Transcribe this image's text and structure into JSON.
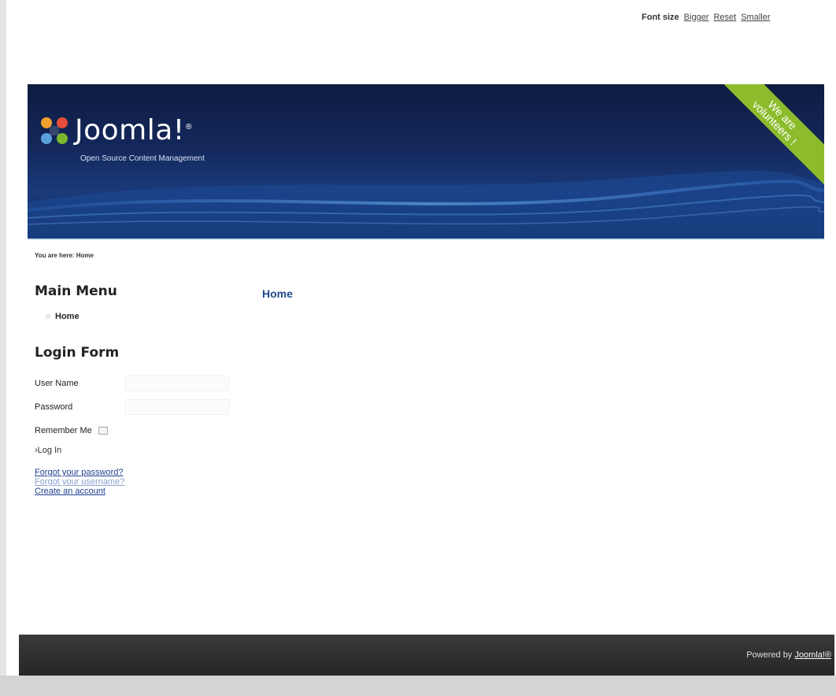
{
  "fontsize": {
    "label": "Font size",
    "bigger": "Bigger",
    "reset": "Reset",
    "smaller": "Smaller"
  },
  "header": {
    "logo_text": "Joomla!",
    "logo_reg": "®",
    "tagline": "Open Source Content Management",
    "ribbon_line1": "We are",
    "ribbon_line2": "volunteers !",
    "colors": {
      "background": "#13275a",
      "ribbon": "#8cbc2c"
    },
    "logo_icon": "joomla-logo-icon"
  },
  "breadcrumb": {
    "text": "You are here: Home"
  },
  "main_menu": {
    "title": "Main Menu",
    "items": [
      {
        "label": "Home"
      }
    ]
  },
  "login_form": {
    "title": "Login Form",
    "username_label": "User Name",
    "password_label": "Password",
    "remember_label": "Remember Me",
    "login_button": "›Log In",
    "forgot_password": "Forgot your password?",
    "forgot_username": "Forgot your username?",
    "create_account": "Create an account"
  },
  "content": {
    "title": "Home"
  },
  "footer": {
    "powered_by": "Powered by",
    "link": "Joomla!®"
  }
}
